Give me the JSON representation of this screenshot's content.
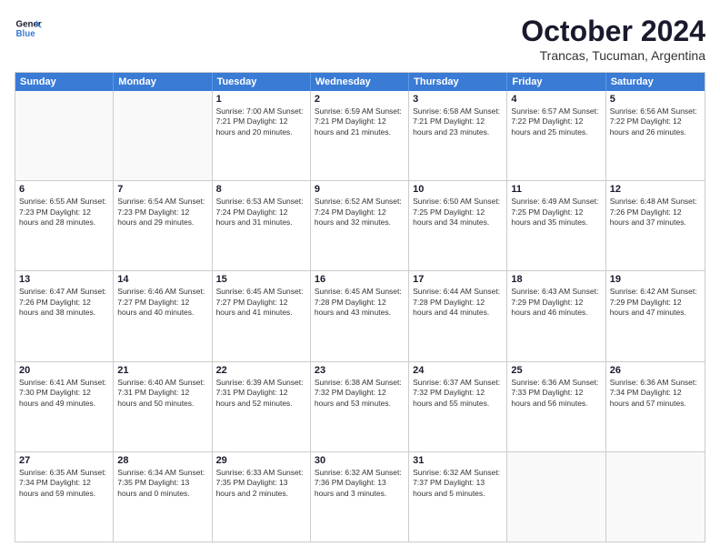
{
  "logo": {
    "line1": "General",
    "line2": "Blue"
  },
  "title": "October 2024",
  "location": "Trancas, Tucuman, Argentina",
  "header_days": [
    "Sunday",
    "Monday",
    "Tuesday",
    "Wednesday",
    "Thursday",
    "Friday",
    "Saturday"
  ],
  "weeks": [
    [
      {
        "day": "",
        "info": ""
      },
      {
        "day": "",
        "info": ""
      },
      {
        "day": "1",
        "info": "Sunrise: 7:00 AM\nSunset: 7:21 PM\nDaylight: 12 hours\nand 20 minutes."
      },
      {
        "day": "2",
        "info": "Sunrise: 6:59 AM\nSunset: 7:21 PM\nDaylight: 12 hours\nand 21 minutes."
      },
      {
        "day": "3",
        "info": "Sunrise: 6:58 AM\nSunset: 7:21 PM\nDaylight: 12 hours\nand 23 minutes."
      },
      {
        "day": "4",
        "info": "Sunrise: 6:57 AM\nSunset: 7:22 PM\nDaylight: 12 hours\nand 25 minutes."
      },
      {
        "day": "5",
        "info": "Sunrise: 6:56 AM\nSunset: 7:22 PM\nDaylight: 12 hours\nand 26 minutes."
      }
    ],
    [
      {
        "day": "6",
        "info": "Sunrise: 6:55 AM\nSunset: 7:23 PM\nDaylight: 12 hours\nand 28 minutes."
      },
      {
        "day": "7",
        "info": "Sunrise: 6:54 AM\nSunset: 7:23 PM\nDaylight: 12 hours\nand 29 minutes."
      },
      {
        "day": "8",
        "info": "Sunrise: 6:53 AM\nSunset: 7:24 PM\nDaylight: 12 hours\nand 31 minutes."
      },
      {
        "day": "9",
        "info": "Sunrise: 6:52 AM\nSunset: 7:24 PM\nDaylight: 12 hours\nand 32 minutes."
      },
      {
        "day": "10",
        "info": "Sunrise: 6:50 AM\nSunset: 7:25 PM\nDaylight: 12 hours\nand 34 minutes."
      },
      {
        "day": "11",
        "info": "Sunrise: 6:49 AM\nSunset: 7:25 PM\nDaylight: 12 hours\nand 35 minutes."
      },
      {
        "day": "12",
        "info": "Sunrise: 6:48 AM\nSunset: 7:26 PM\nDaylight: 12 hours\nand 37 minutes."
      }
    ],
    [
      {
        "day": "13",
        "info": "Sunrise: 6:47 AM\nSunset: 7:26 PM\nDaylight: 12 hours\nand 38 minutes."
      },
      {
        "day": "14",
        "info": "Sunrise: 6:46 AM\nSunset: 7:27 PM\nDaylight: 12 hours\nand 40 minutes."
      },
      {
        "day": "15",
        "info": "Sunrise: 6:45 AM\nSunset: 7:27 PM\nDaylight: 12 hours\nand 41 minutes."
      },
      {
        "day": "16",
        "info": "Sunrise: 6:45 AM\nSunset: 7:28 PM\nDaylight: 12 hours\nand 43 minutes."
      },
      {
        "day": "17",
        "info": "Sunrise: 6:44 AM\nSunset: 7:28 PM\nDaylight: 12 hours\nand 44 minutes."
      },
      {
        "day": "18",
        "info": "Sunrise: 6:43 AM\nSunset: 7:29 PM\nDaylight: 12 hours\nand 46 minutes."
      },
      {
        "day": "19",
        "info": "Sunrise: 6:42 AM\nSunset: 7:29 PM\nDaylight: 12 hours\nand 47 minutes."
      }
    ],
    [
      {
        "day": "20",
        "info": "Sunrise: 6:41 AM\nSunset: 7:30 PM\nDaylight: 12 hours\nand 49 minutes."
      },
      {
        "day": "21",
        "info": "Sunrise: 6:40 AM\nSunset: 7:31 PM\nDaylight: 12 hours\nand 50 minutes."
      },
      {
        "day": "22",
        "info": "Sunrise: 6:39 AM\nSunset: 7:31 PM\nDaylight: 12 hours\nand 52 minutes."
      },
      {
        "day": "23",
        "info": "Sunrise: 6:38 AM\nSunset: 7:32 PM\nDaylight: 12 hours\nand 53 minutes."
      },
      {
        "day": "24",
        "info": "Sunrise: 6:37 AM\nSunset: 7:32 PM\nDaylight: 12 hours\nand 55 minutes."
      },
      {
        "day": "25",
        "info": "Sunrise: 6:36 AM\nSunset: 7:33 PM\nDaylight: 12 hours\nand 56 minutes."
      },
      {
        "day": "26",
        "info": "Sunrise: 6:36 AM\nSunset: 7:34 PM\nDaylight: 12 hours\nand 57 minutes."
      }
    ],
    [
      {
        "day": "27",
        "info": "Sunrise: 6:35 AM\nSunset: 7:34 PM\nDaylight: 12 hours\nand 59 minutes."
      },
      {
        "day": "28",
        "info": "Sunrise: 6:34 AM\nSunset: 7:35 PM\nDaylight: 13 hours\nand 0 minutes."
      },
      {
        "day": "29",
        "info": "Sunrise: 6:33 AM\nSunset: 7:35 PM\nDaylight: 13 hours\nand 2 minutes."
      },
      {
        "day": "30",
        "info": "Sunrise: 6:32 AM\nSunset: 7:36 PM\nDaylight: 13 hours\nand 3 minutes."
      },
      {
        "day": "31",
        "info": "Sunrise: 6:32 AM\nSunset: 7:37 PM\nDaylight: 13 hours\nand 5 minutes."
      },
      {
        "day": "",
        "info": ""
      },
      {
        "day": "",
        "info": ""
      }
    ]
  ]
}
